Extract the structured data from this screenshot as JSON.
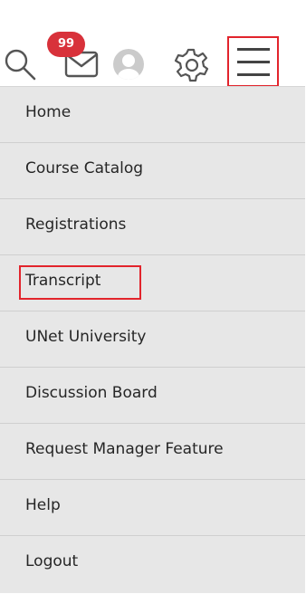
{
  "header": {
    "notification_count": "99",
    "icons": {
      "search": "search-icon",
      "mail": "mail-icon",
      "avatar": "user-avatar-icon",
      "settings": "gear-icon",
      "menu": "hamburger-menu-icon"
    },
    "colors": {
      "badge": "#d8313a",
      "highlight_border": "#e2242c"
    }
  },
  "menu": {
    "items": [
      {
        "label": "Home"
      },
      {
        "label": "Course Catalog"
      },
      {
        "label": "Registrations"
      },
      {
        "label": "Transcript"
      },
      {
        "label": "UNet University"
      },
      {
        "label": "Discussion Board"
      },
      {
        "label": "Request Manager Feature"
      },
      {
        "label": "Help"
      },
      {
        "label": "Logout"
      }
    ],
    "background": "#e7e7e7"
  }
}
